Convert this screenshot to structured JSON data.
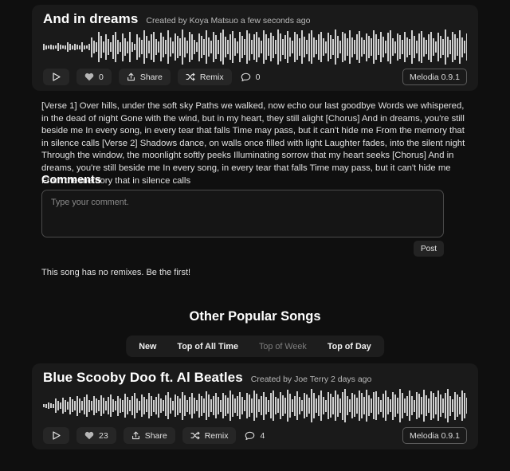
{
  "theme": {
    "page_bg": "#0f0f0f",
    "card_bg": "#1a1a1a",
    "waveform_color": "#cfcfcf",
    "text_primary": "#ffffff",
    "text_secondary": "#b9b9b9"
  },
  "main_song": {
    "title": "And in dreams",
    "meta": "Created by Koya Matsuo a few seconds ago",
    "play_label": "",
    "like_count": "0",
    "share_label": "Share",
    "remix_label": "Remix",
    "comment_count": "0",
    "version_badge": "Melodia 0.9.1",
    "waveform": [
      6,
      4,
      3,
      5,
      4,
      3,
      8,
      5,
      3,
      4,
      10,
      6,
      4,
      7,
      5,
      4,
      9,
      4,
      3,
      6,
      20,
      13,
      9,
      30,
      22,
      11,
      26,
      16,
      9,
      24,
      30,
      14,
      10,
      28,
      17,
      12,
      30,
      9,
      7,
      26,
      20,
      14,
      34,
      22,
      13,
      25,
      31,
      16,
      11,
      29,
      21,
      15,
      33,
      19,
      12,
      27,
      23,
      17,
      35,
      20,
      13,
      30,
      25,
      14,
      10,
      28,
      22,
      16,
      34,
      19,
      13,
      31,
      24,
      15,
      29,
      36,
      21,
      14,
      26,
      32,
      18,
      12,
      30,
      23,
      16,
      34,
      27,
      15,
      25,
      31,
      20,
      13,
      33,
      26,
      17,
      29,
      22,
      14,
      35,
      28,
      16,
      24,
      32,
      19,
      13,
      30,
      25,
      18,
      34,
      21,
      15,
      28,
      33,
      20,
      14,
      26,
      31,
      17,
      12,
      29,
      24,
      16,
      35,
      22,
      13,
      30,
      27,
      18,
      33,
      20,
      15,
      25,
      32,
      19,
      14,
      28,
      23,
      17,
      34,
      26,
      16,
      30,
      21,
      13,
      29,
      33,
      18,
      12,
      27,
      24,
      15,
      31,
      20,
      16,
      34,
      22,
      13,
      28,
      32,
      19,
      14,
      26,
      30,
      17,
      11,
      29,
      23,
      16,
      35,
      21,
      14,
      31,
      25,
      18,
      33,
      20,
      13,
      27,
      32,
      17,
      12,
      30,
      24,
      16,
      34,
      22,
      15,
      28,
      31,
      19,
      13,
      26,
      33,
      18,
      14,
      29,
      23,
      16,
      35,
      21,
      12,
      30,
      27,
      17,
      32,
      20,
      14,
      25,
      31,
      19,
      13,
      28,
      24,
      16,
      34,
      22,
      15,
      29,
      33,
      18,
      12,
      27,
      30,
      17,
      14,
      26,
      23,
      15,
      31,
      21,
      13,
      34,
      25,
      18,
      32,
      20,
      14,
      29,
      27,
      16,
      30,
      22,
      13,
      28,
      33,
      19,
      15,
      26,
      31,
      17,
      12,
      35,
      24,
      16,
      30,
      21,
      14,
      29,
      23,
      18,
      33,
      20,
      13,
      27,
      32,
      17,
      11,
      26,
      30,
      16,
      14,
      28,
      22,
      15,
      34,
      21,
      13,
      31,
      25,
      17,
      29,
      33,
      19,
      12,
      27,
      24,
      16,
      30,
      20,
      14,
      35,
      22,
      15,
      28,
      32,
      18,
      13,
      26,
      31,
      17,
      12,
      29,
      23,
      16,
      34,
      21,
      14,
      30,
      27,
      18,
      33,
      20,
      13,
      25,
      31,
      19,
      15,
      28,
      24,
      16,
      32,
      22,
      14,
      29,
      33,
      17,
      12,
      27,
      30,
      18,
      13,
      26,
      23,
      15,
      31,
      21,
      16,
      34,
      25,
      17,
      29,
      20,
      14,
      28,
      32,
      19,
      13,
      30,
      24,
      16,
      27,
      22,
      15,
      33,
      21,
      13,
      29,
      26,
      18,
      31,
      20,
      14,
      25,
      30,
      17,
      12,
      28,
      23,
      16,
      34,
      22,
      14,
      31,
      27,
      17,
      29,
      33,
      18,
      13,
      26,
      24,
      15,
      30,
      21,
      16,
      32,
      20,
      13,
      28,
      25,
      18,
      34,
      22,
      14,
      29,
      31,
      17,
      12,
      27,
      30,
      16,
      13,
      26,
      23,
      15,
      33,
      21,
      17,
      31,
      25,
      14,
      28,
      20,
      13,
      30,
      24,
      16,
      35,
      22,
      15,
      27,
      32,
      18,
      12,
      29,
      26,
      17,
      31,
      21,
      14,
      25,
      33,
      19,
      13,
      28,
      23,
      16,
      30,
      20,
      15,
      34,
      22,
      13,
      29,
      27,
      18,
      32,
      21,
      14,
      26,
      31,
      17,
      12,
      30,
      24,
      16,
      28,
      20,
      13,
      33,
      25,
      18,
      29,
      22,
      15,
      27,
      31,
      17,
      14,
      26,
      23,
      16,
      34,
      21,
      13,
      30,
      27,
      19,
      32,
      20,
      14,
      28,
      24,
      16,
      29,
      33,
      18,
      12,
      26,
      22,
      15,
      31,
      21,
      17,
      30,
      25,
      13,
      27,
      20,
      16,
      34,
      23,
      14,
      29,
      32,
      18,
      13,
      28,
      26,
      17,
      31,
      22,
      15,
      25,
      30,
      19,
      12,
      27,
      24,
      16,
      33,
      21,
      14,
      29,
      31,
      18,
      13,
      26,
      23,
      16,
      30,
      20,
      15,
      28,
      22,
      13,
      34,
      25,
      17,
      31,
      21,
      14,
      27,
      32,
      18,
      12,
      29,
      26,
      16,
      30,
      23,
      15,
      25,
      21,
      13,
      28,
      24,
      17,
      33,
      20,
      14,
      29,
      31,
      18,
      13,
      26,
      22,
      16,
      30,
      25,
      15,
      27,
      21,
      13,
      32,
      23,
      17,
      29,
      20,
      14,
      28,
      26,
      16,
      31,
      22,
      13,
      25,
      30,
      18,
      12,
      27,
      24,
      16,
      34,
      21,
      15,
      29,
      23,
      14,
      30,
      26,
      17,
      32,
      20,
      13,
      28,
      22,
      16,
      31,
      25,
      18,
      27,
      21,
      14,
      26,
      30,
      17,
      12,
      29,
      23,
      15,
      33,
      22,
      16,
      28,
      20,
      13,
      31,
      24,
      17,
      29,
      21,
      14,
      27,
      32,
      18,
      13,
      26,
      25,
      16,
      30,
      22,
      15,
      28,
      20,
      13,
      33,
      26,
      17,
      29,
      23,
      14,
      31,
      21,
      16,
      27,
      30,
      18,
      12,
      25,
      24,
      15,
      28,
      22,
      14,
      8,
      6,
      4
    ]
  },
  "lyrics": "[Verse 1] Over hills, under the soft sky Paths we walked, now echo our last goodbye Words we whispered, in the dead of night Gone with the wind, but in my heart, they still alight [Chorus] And in dreams, you're still beside me In every song, in every tear that falls Time may pass, but it can't hide me From the memory that in silence calls [Verse 2] Shadows dance, on walls once filled with light Laughter fades, into the silent night Through the window, the moonlight softly peeks Illuminating sorrow that my heart seeks [Chorus] And in dreams, you're still beside me In every song, in every tear that falls Time may pass, but it can't hide me From the memory that in silence calls",
  "comments": {
    "heading": "Comments",
    "placeholder": "Type your comment.",
    "value": "",
    "post_label": "Post"
  },
  "remix_notice": "This song has no remixes. Be the first!",
  "other_section": {
    "heading": "Other Popular Songs",
    "tabs": [
      {
        "label": "New",
        "dim": false
      },
      {
        "label": "Top of All Time",
        "dim": false
      },
      {
        "label": "Top of Week",
        "dim": true
      },
      {
        "label": "Top of Day",
        "dim": false
      }
    ]
  },
  "other_song": {
    "title": "Blue Scooby Doo ft. Al Beatles",
    "meta": "Created by Joe Terry 2 days ago",
    "like_count": "23",
    "share_label": "Share",
    "remix_label": "Remix",
    "comment_count": "4",
    "version_badge": "Melodia 0.9.1",
    "waveform": [
      3,
      4,
      6,
      5,
      4,
      14,
      10,
      7,
      16,
      12,
      8,
      18,
      13,
      9,
      20,
      15,
      10,
      17,
      22,
      12,
      9,
      19,
      14,
      11,
      21,
      16,
      10,
      18,
      23,
      13,
      9,
      20,
      15,
      12,
      24,
      17,
      11,
      19,
      25,
      14,
      10,
      22,
      18,
      13,
      26,
      20,
      12,
      17,
      24,
      15,
      11,
      21,
      27,
      16,
      10,
      23,
      19,
      14,
      28,
      21,
      12,
      18,
      25,
      16,
      11,
      24,
      20,
      15,
      29,
      22,
      13,
      19,
      26,
      17,
      12,
      25,
      21,
      16,
      30,
      23,
      14,
      20,
      27,
      18,
      11,
      26,
      22,
      15,
      31,
      24,
      13,
      19,
      28,
      17,
      12,
      25,
      30,
      18,
      14,
      27,
      21,
      16,
      32,
      24,
      13,
      20,
      29,
      17,
      11,
      26,
      23,
      16,
      33,
      25,
      14,
      21,
      30,
      18,
      12,
      27,
      24,
      17,
      31,
      22,
      15,
      28,
      34,
      19,
      13,
      26,
      23,
      16,
      30,
      25,
      18,
      32,
      21,
      14,
      27,
      29,
      17,
      12,
      24,
      31,
      18,
      13,
      28,
      22,
      16,
      33,
      26,
      15,
      20,
      30,
      19,
      12,
      27,
      24,
      17,
      32,
      21,
      14,
      29,
      26,
      18,
      31,
      23,
      15,
      25,
      34,
      20,
      13,
      28,
      22,
      17,
      30,
      26,
      16,
      21,
      33,
      19,
      12,
      27,
      25,
      18,
      31,
      23,
      14,
      29,
      20,
      16,
      34,
      26,
      15,
      22,
      30,
      19,
      13,
      28,
      24,
      17,
      32,
      21,
      14,
      26,
      31,
      18,
      12,
      29,
      23,
      16,
      35,
      25,
      15,
      20,
      33,
      19,
      13,
      27,
      24,
      18,
      30,
      22,
      16,
      28,
      34,
      20,
      12,
      26,
      23,
      17,
      31,
      25,
      14,
      21,
      29,
      18,
      13,
      32,
      26,
      16,
      27,
      22,
      15,
      30,
      24,
      19,
      33,
      21,
      13,
      28,
      25,
      17,
      31,
      20,
      14,
      26,
      34,
      18,
      12,
      29,
      23,
      16,
      30,
      27,
      15,
      22,
      32,
      19,
      13,
      25,
      28,
      17,
      34,
      21,
      14,
      30,
      26,
      18,
      23,
      31,
      16,
      12,
      27,
      24,
      20,
      33,
      22,
      15,
      29,
      26,
      17,
      31,
      20,
      13,
      28,
      25,
      18,
      32,
      21,
      14,
      27,
      30,
      16,
      12,
      26,
      23,
      17,
      34,
      22,
      15,
      29,
      31,
      19,
      13,
      25,
      27,
      16,
      30,
      24,
      18,
      33,
      21,
      14,
      28,
      26,
      17,
      22,
      31,
      19,
      12,
      29,
      23,
      16,
      34,
      25,
      15,
      27,
      30,
      18,
      13,
      26,
      22,
      17,
      32,
      24,
      14,
      21,
      29,
      19,
      13,
      31,
      26,
      16,
      28,
      23,
      15,
      33,
      25,
      18,
      20,
      30,
      17,
      12,
      27,
      24,
      16,
      34,
      22,
      14,
      29,
      31,
      19,
      13,
      26,
      25,
      17,
      30,
      21,
      15,
      28,
      33,
      18,
      12,
      27,
      23,
      16,
      31,
      26,
      19,
      24,
      30,
      14,
      13,
      29,
      22,
      17,
      32,
      25,
      15,
      21,
      28,
      18,
      12,
      26,
      31,
      17,
      14,
      30,
      23,
      16,
      27,
      34,
      19,
      13,
      25,
      29,
      18,
      12,
      28,
      24,
      16,
      31,
      22,
      15,
      33,
      26,
      17,
      20,
      30,
      19,
      13,
      27,
      25,
      18,
      32,
      21,
      14,
      29,
      23,
      16,
      26,
      31,
      17,
      12,
      28,
      24,
      19,
      33,
      22,
      15,
      30,
      27,
      16,
      21,
      29,
      18,
      13,
      25,
      32,
      17,
      14,
      26,
      23,
      16,
      31,
      28,
      19,
      12,
      27,
      24,
      15,
      34,
      22,
      17,
      29,
      30,
      18,
      13,
      26,
      25,
      16,
      21,
      31,
      19,
      12,
      28,
      23,
      17,
      32,
      26,
      14,
      30,
      22,
      15,
      27,
      29,
      18,
      13,
      25,
      24,
      16,
      33,
      21,
      17,
      28,
      30,
      19,
      12,
      26,
      23,
      15,
      31,
      27,
      18,
      22,
      29,
      16,
      13,
      25,
      24,
      17,
      32,
      20,
      14,
      28,
      26,
      18,
      31,
      23,
      15,
      27,
      30,
      19,
      12,
      24,
      22,
      16,
      29,
      25,
      17,
      33,
      21,
      13,
      28,
      26,
      18,
      20,
      31,
      16,
      14,
      27,
      23,
      17,
      30,
      24,
      15,
      29,
      22,
      13,
      26,
      31,
      18,
      12,
      25,
      27,
      16,
      32,
      21,
      15,
      28,
      24,
      17,
      30,
      23,
      14,
      26,
      29,
      18,
      13,
      27,
      22,
      16,
      31,
      25,
      19,
      21,
      28,
      15,
      12,
      30,
      24,
      17,
      26,
      23,
      16,
      29,
      27,
      18,
      32,
      20,
      14,
      25,
      31,
      17,
      13,
      28,
      22,
      16,
      27,
      24,
      19,
      30,
      21,
      15,
      26,
      29,
      17,
      12,
      23,
      25,
      18,
      31,
      22,
      14,
      28,
      27,
      16,
      20,
      30,
      19,
      13,
      26,
      24,
      17,
      29,
      23,
      15,
      31,
      21,
      16,
      27,
      28,
      18,
      12,
      25,
      22,
      16,
      30,
      26,
      17,
      24,
      29,
      15,
      13,
      27,
      23,
      18,
      31,
      20,
      14,
      26,
      25,
      17,
      30,
      22,
      16,
      28,
      21,
      13,
      29,
      24,
      18,
      32,
      23,
      15,
      26,
      27,
      17,
      12,
      25,
      30,
      19,
      13,
      28,
      22,
      16,
      5,
      4,
      3
    ]
  }
}
